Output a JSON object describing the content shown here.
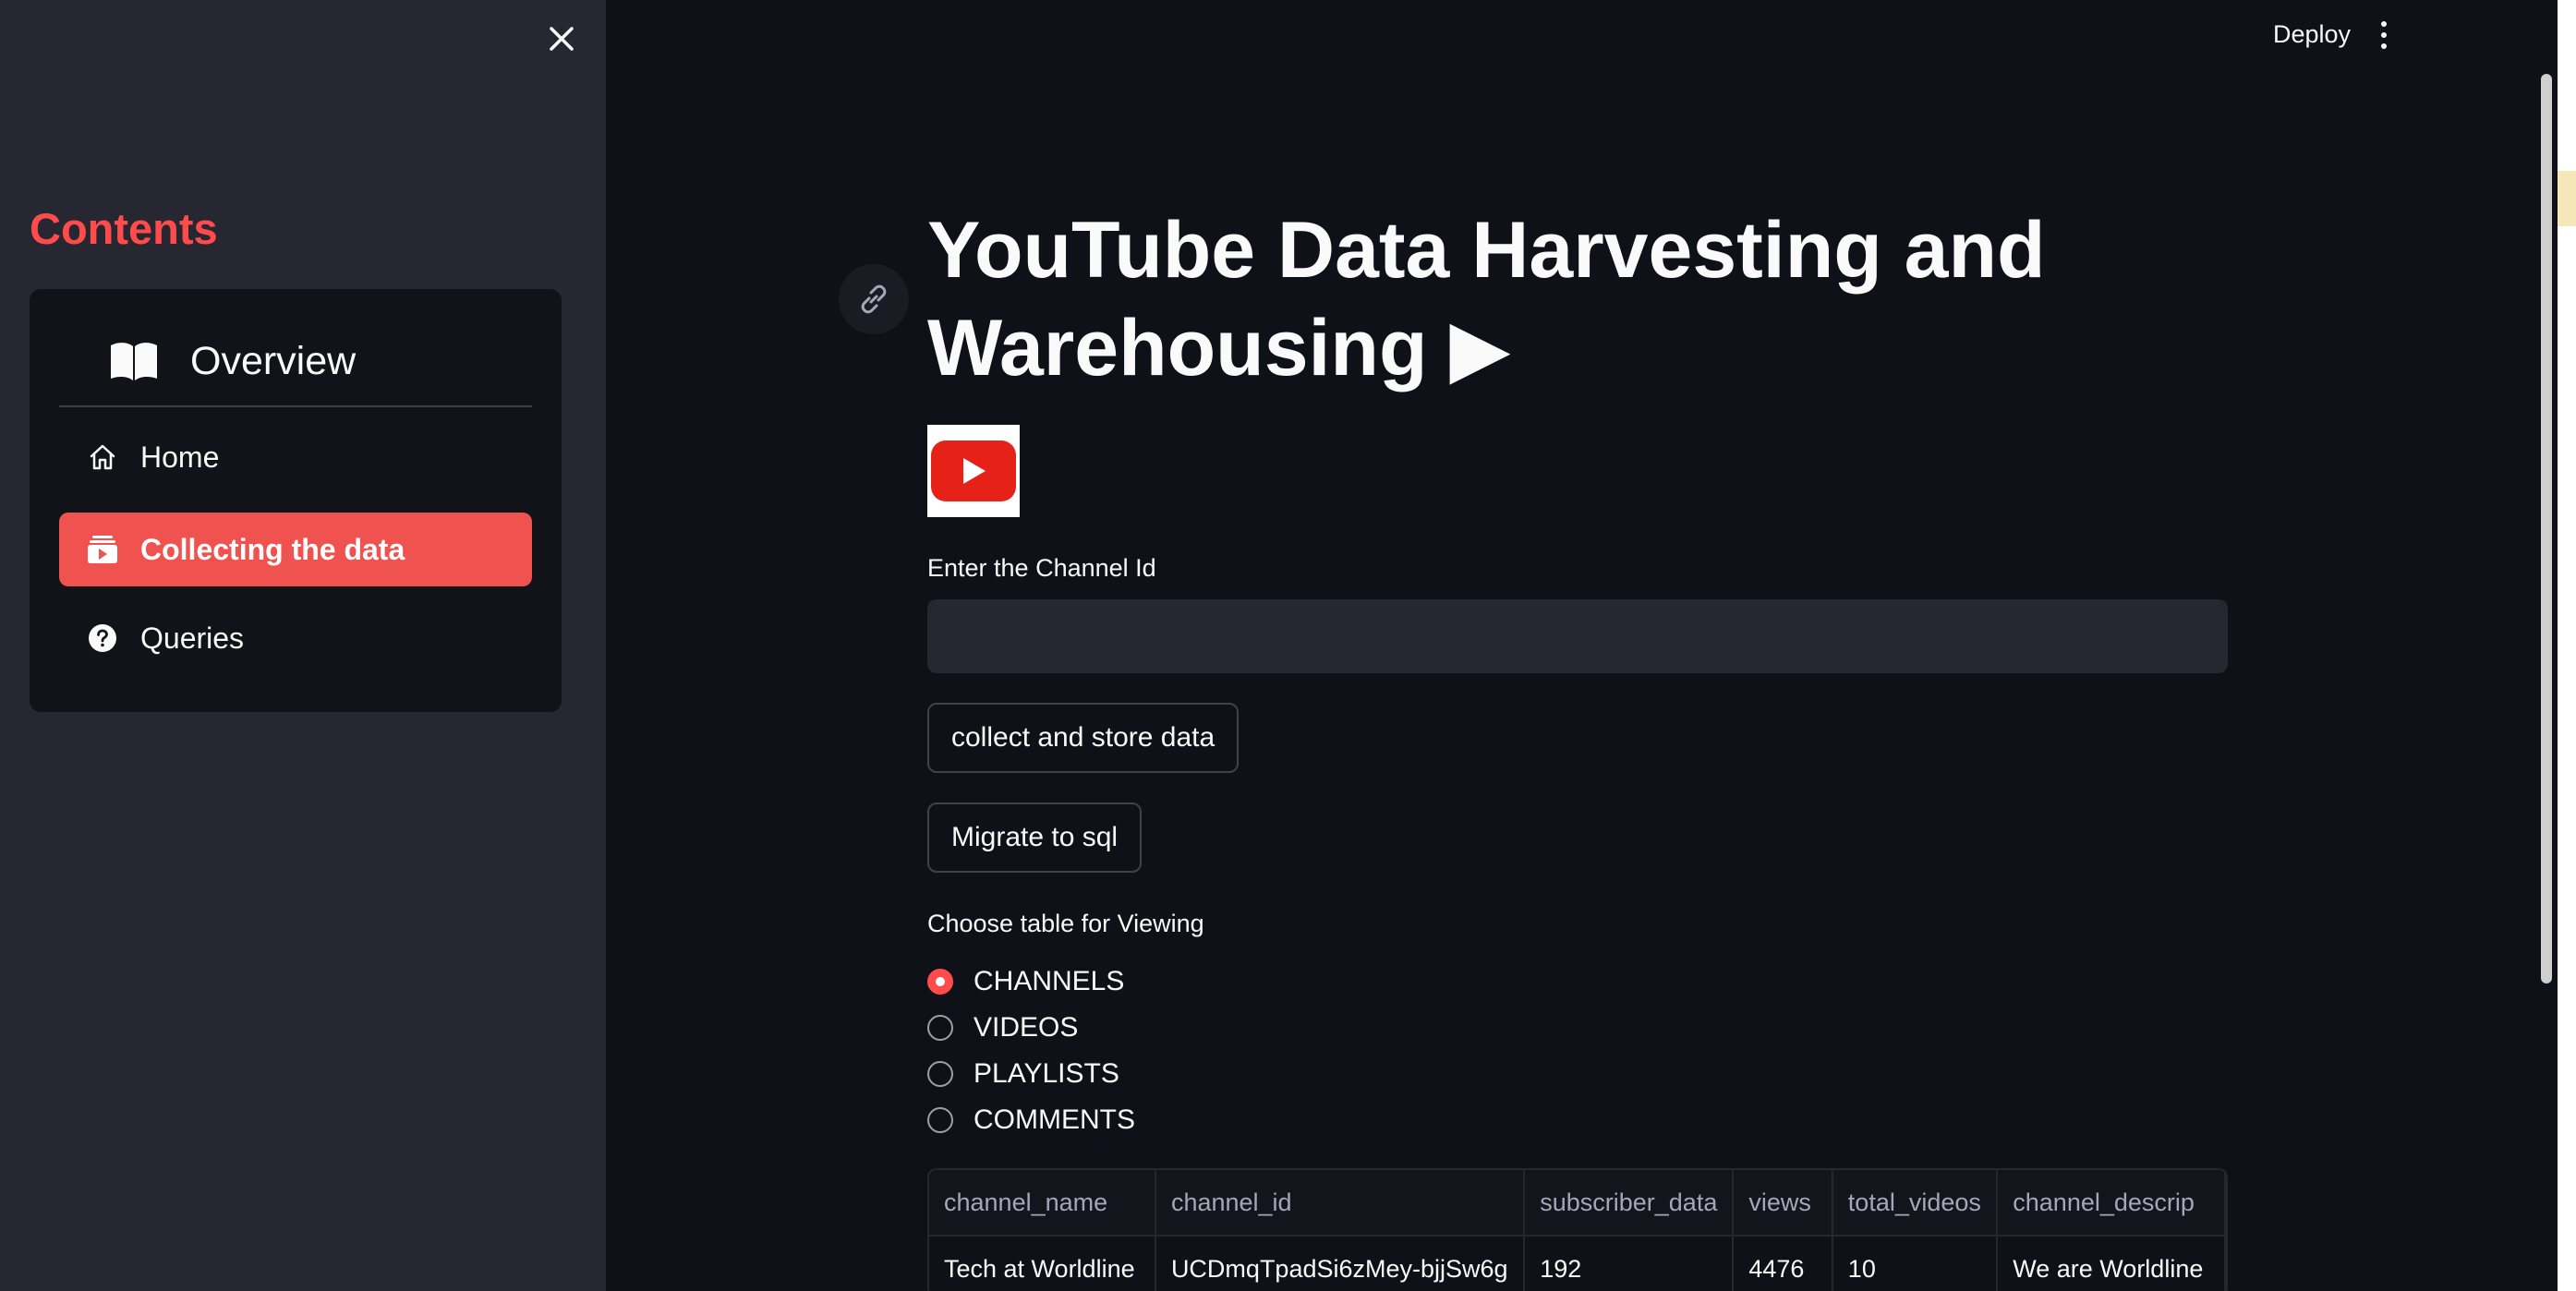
{
  "sidebar": {
    "heading": "Contents",
    "menu": {
      "header_label": "Overview",
      "items": [
        {
          "label": "Home",
          "icon": "home-icon",
          "active": false
        },
        {
          "label": "Collecting the data",
          "icon": "youtube-icon",
          "active": true
        },
        {
          "label": "Queries",
          "icon": "question-icon",
          "active": false
        }
      ]
    }
  },
  "header": {
    "deploy_label": "Deploy"
  },
  "main": {
    "title": "YouTube Data Harvesting and Warehousing ▶",
    "channel_input": {
      "label": "Enter the Channel Id",
      "value": "",
      "placeholder": ""
    },
    "buttons": {
      "collect": "collect and store data",
      "migrate": "Migrate to sql"
    },
    "radio": {
      "label": "Choose table for Viewing",
      "options": [
        "CHANNELS",
        "VIDEOS",
        "PLAYLISTS",
        "COMMENTS"
      ],
      "selected": "CHANNELS"
    },
    "table": {
      "columns": [
        "channel_name",
        "channel_id",
        "subscriber_data",
        "views",
        "total_videos",
        "channel_descrip"
      ],
      "rows": [
        [
          "Tech at Worldline",
          "UCDmqTpadSi6zMey-bjjSw6g",
          "192",
          "4476",
          "10",
          "We are Worldline"
        ]
      ]
    }
  },
  "colors": {
    "accent": "#ff4b4b",
    "active_menu": "#f0524f",
    "sidebar_bg": "#262730",
    "main_bg": "#0e1117"
  }
}
